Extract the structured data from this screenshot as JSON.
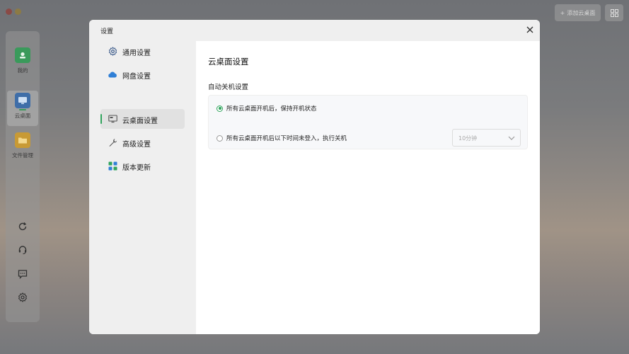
{
  "window": {
    "add_desktop_label": "添加云桌面"
  },
  "sidebar": {
    "apps": [
      {
        "label": "我的",
        "icon": "user-icon"
      },
      {
        "label": "云桌面",
        "icon": "desktop-icon"
      },
      {
        "label": "文件管理",
        "icon": "folder-icon"
      }
    ],
    "tools": [
      "refresh-icon",
      "headset-icon",
      "chat-icon",
      "gear-icon"
    ]
  },
  "dialog": {
    "title": "设置",
    "nav": [
      {
        "label": "通用设置",
        "icon": "gear-icon"
      },
      {
        "label": "网盘设置",
        "icon": "cloud-icon"
      },
      {
        "label": "云桌面设置",
        "icon": "desktop-icon",
        "active": true
      },
      {
        "label": "高级设置",
        "icon": "wrench-icon"
      },
      {
        "label": "版本更新",
        "icon": "apps-icon"
      }
    ],
    "content": {
      "title": "云桌面设置",
      "section_title": "自动关机设置",
      "option_keep": "所有云桌面开机后，保持开机状态",
      "option_shutdown": "所有云桌面开机后以下时间未登入，执行关机",
      "shutdown_delay": "10分钟"
    }
  },
  "colors": {
    "accent": "#2fa35c"
  }
}
